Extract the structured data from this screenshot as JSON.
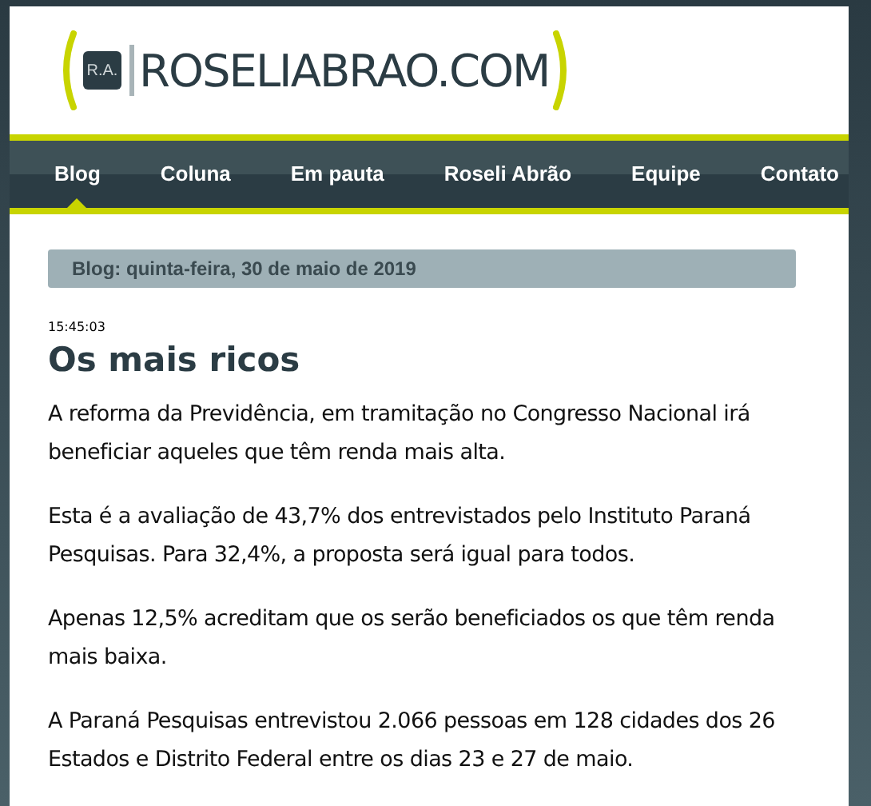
{
  "logo": {
    "badge": "R.A.",
    "text": "ROSELIABRAO.COM"
  },
  "nav": [
    {
      "label": "Blog",
      "selected": true
    },
    {
      "label": "Coluna",
      "selected": false
    },
    {
      "label": "Em pauta",
      "selected": false
    },
    {
      "label": "Roseli Abrão",
      "selected": false
    },
    {
      "label": "Equipe",
      "selected": false
    },
    {
      "label": "Contato",
      "selected": false
    }
  ],
  "date_banner": "Blog: quinta-feira, 30 de maio de 2019",
  "post": {
    "time": "15:45:03",
    "title": "Os mais ricos",
    "paragraphs": [
      "A reforma da Previdência, em tramitação no Congresso Nacional irá beneficiar aqueles que têm renda mais alta.",
      "Esta é a avaliação de 43,7% dos entrevistados pelo Instituto Paraná Pesquisas. Para 32,4%, a proposta será igual para todos.",
      "Apenas 12,5% acreditam que os serão beneficiados os que têm renda mais baixa.",
      "A Paraná Pesquisas entrevistou 2.066 pessoas em 128 cidades dos 26 Estados e Distrito Federal entre os dias 23 e 27 de maio."
    ]
  }
}
